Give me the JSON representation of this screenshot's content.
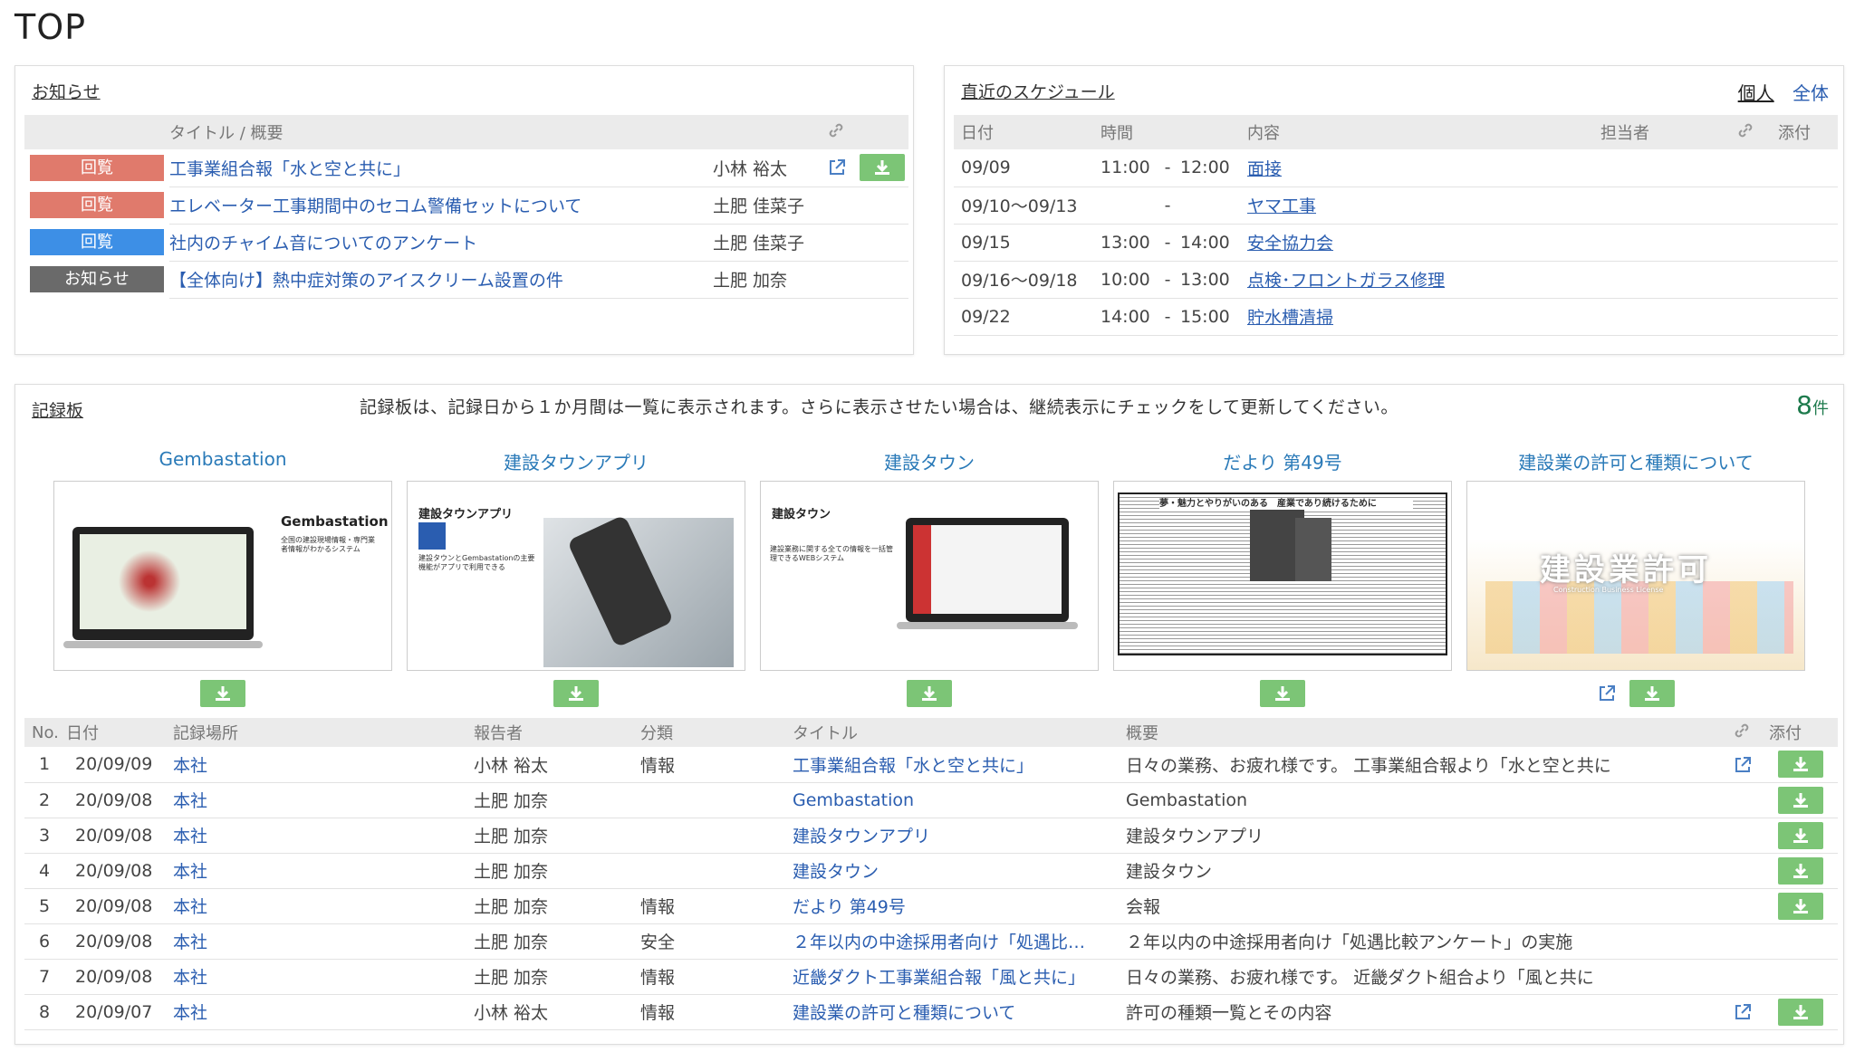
{
  "page": {
    "title": "TOP"
  },
  "notice": {
    "heading": "お知らせ",
    "col_title": "タイトル / 概要",
    "rows": [
      {
        "category": "回覧",
        "color": "#e07a6c",
        "title": "工事業組合報「水と空と共に」",
        "author": "小林 裕太",
        "has_link": true,
        "has_download": true
      },
      {
        "category": "回覧",
        "color": "#e07a6c",
        "title": "エレベーター工事期間中のセコム警備セットについて",
        "author": "土肥 佳菜子",
        "has_link": false,
        "has_download": false
      },
      {
        "category": "回覧",
        "color": "#3d8fe6",
        "title": "社内のチャイム音についてのアンケート",
        "author": "土肥 佳菜子",
        "has_link": false,
        "has_download": false
      },
      {
        "category": "お知らせ",
        "color": "#6a6a6a",
        "title": "【全体向け】熱中症対策のアイスクリーム設置の件",
        "author": "土肥 加奈",
        "has_link": false,
        "has_download": false
      }
    ]
  },
  "schedule": {
    "heading": "直近のスケジュール",
    "link_personal": "個人",
    "link_all": "全体",
    "columns": {
      "date": "日付",
      "time": "時間",
      "content": "内容",
      "person": "担当者",
      "attach": "添付"
    },
    "rows": [
      {
        "date": "09/09",
        "start": "11:00",
        "sep": "-",
        "end": "12:00",
        "content": "面接"
      },
      {
        "date": "09/10〜09/13",
        "start": "",
        "sep": "-",
        "end": "",
        "content": "ヤマ工事"
      },
      {
        "date": "09/15",
        "start": "13:00",
        "sep": "-",
        "end": "14:00",
        "content": "安全協力会"
      },
      {
        "date": "09/16〜09/18",
        "start": "10:00",
        "sep": "-",
        "end": "13:00",
        "content": "点検･フロントガラス修理"
      },
      {
        "date": "09/22",
        "start": "14:00",
        "sep": "-",
        "end": "15:00",
        "content": "貯水槽清掃"
      }
    ]
  },
  "board": {
    "heading": "記録板",
    "message": "記録板は、記録日から１か月間は一覧に表示されます。さらに表示させたい場合は、継続表示にチェックをして更新してください。",
    "count": "8",
    "count_unit": "件",
    "thumbnails": [
      {
        "title": "Gembastation",
        "brand": "Gembastation",
        "caption": "全国の建設現場情報・専門業者情報がわかるシステム",
        "has_link": false
      },
      {
        "title": "建設タウンアプリ",
        "brand": "建設タウンアプリ",
        "caption": "建設タウンとGembastationの主要機能がアプリで利用できる",
        "has_link": false
      },
      {
        "title": "建設タウン",
        "brand": "建設タウン",
        "caption": "建設業務に関する全ての情報を一括管理できるWEBシステム",
        "has_link": false
      },
      {
        "title": "だより 第49号",
        "brand": "",
        "caption": "夢・魅力とやりがいのある　産業であり続けるために",
        "has_link": false
      },
      {
        "title": "建設業の許可と種類について",
        "brand": "建設業許可",
        "caption": "Construction Business License",
        "has_link": true
      }
    ],
    "columns": {
      "no": "No.",
      "date": "日付",
      "place": "記録場所",
      "reporter": "報告者",
      "category": "分類",
      "title": "タイトル",
      "summary": "概要",
      "attach": "添付"
    },
    "rows": [
      {
        "no": "1",
        "date": "20/09/09",
        "place": "本社",
        "reporter": "小林 裕太",
        "category": "情報",
        "title": "工事業組合報「水と空と共に」",
        "summary": "日々の業務、お疲れ様です。 工事業組合報より「水と空と共に",
        "has_link": true,
        "has_download": true
      },
      {
        "no": "2",
        "date": "20/09/08",
        "place": "本社",
        "reporter": "土肥 加奈",
        "category": "",
        "title": "Gembastation",
        "summary": "Gembastation",
        "has_link": false,
        "has_download": true
      },
      {
        "no": "3",
        "date": "20/09/08",
        "place": "本社",
        "reporter": "土肥 加奈",
        "category": "",
        "title": "建設タウンアプリ",
        "summary": "建設タウンアプリ",
        "has_link": false,
        "has_download": true
      },
      {
        "no": "4",
        "date": "20/09/08",
        "place": "本社",
        "reporter": "土肥 加奈",
        "category": "",
        "title": "建設タウン",
        "summary": "建設タウン",
        "has_link": false,
        "has_download": true
      },
      {
        "no": "5",
        "date": "20/09/08",
        "place": "本社",
        "reporter": "土肥 加奈",
        "category": "情報",
        "title": "だより 第49号",
        "summary": "会報",
        "has_link": false,
        "has_download": true
      },
      {
        "no": "6",
        "date": "20/09/08",
        "place": "本社",
        "reporter": "土肥 加奈",
        "category": "安全",
        "title": "２年以内の中途採用者向け「処遇比…",
        "summary": "２年以内の中途採用者向け「処遇比較アンケート」の実施",
        "has_link": false,
        "has_download": false
      },
      {
        "no": "7",
        "date": "20/09/08",
        "place": "本社",
        "reporter": "土肥 加奈",
        "category": "情報",
        "title": "近畿ダクト工事業組合報「風と共に」",
        "summary": "日々の業務、お疲れ様です。 近畿ダクト組合より「風と共に",
        "has_link": false,
        "has_download": false
      },
      {
        "no": "8",
        "date": "20/09/07",
        "place": "本社",
        "reporter": "小林 裕太",
        "category": "情報",
        "title": "建設業の許可と種類について",
        "summary": "許可の種類一覧とその内容",
        "has_link": true,
        "has_download": true
      }
    ]
  },
  "colors": {
    "link": "#2a5db0",
    "download_button": "#7cc576",
    "count": "#1d7a4c"
  }
}
